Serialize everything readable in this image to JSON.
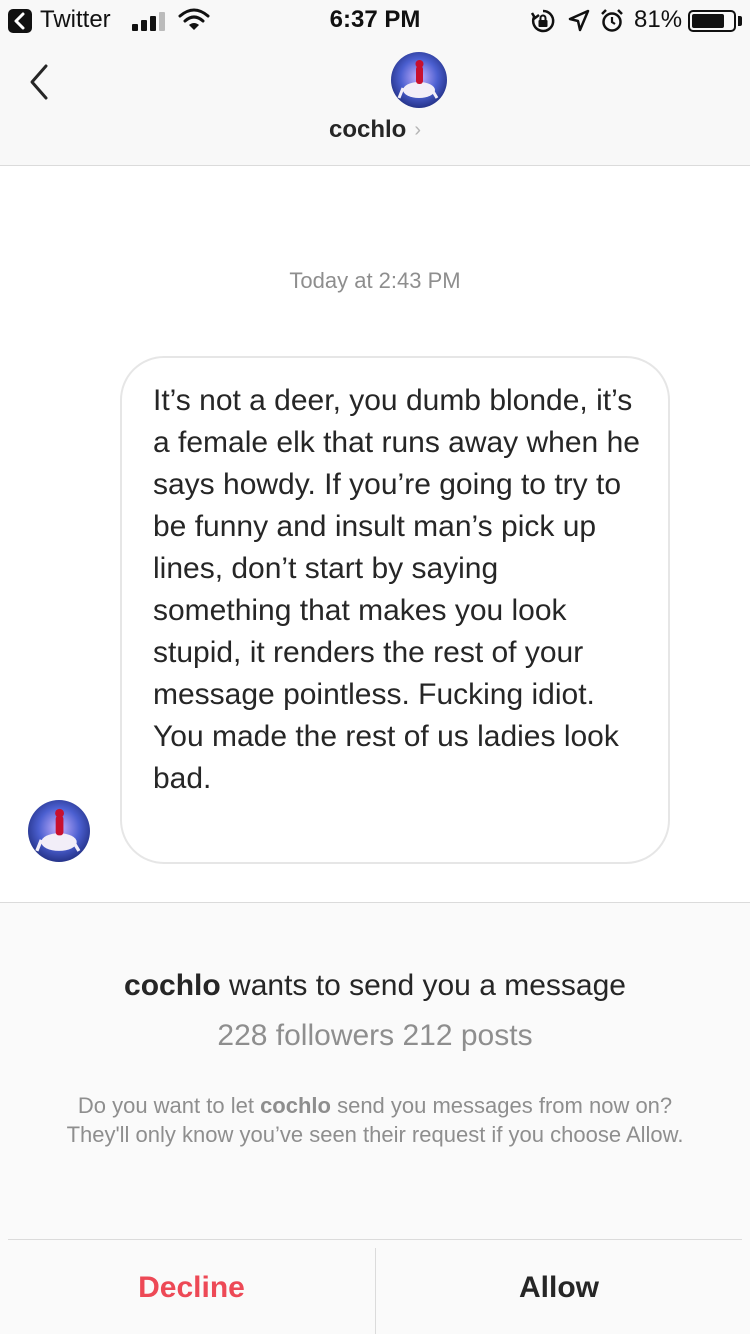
{
  "status_bar": {
    "app_name": "Twitter",
    "time": "6:37 PM",
    "battery_percent": "81%",
    "battery_level": 0.81,
    "icons": [
      "back-to-app-icon",
      "signal-icon",
      "wifi-icon",
      "rotation-lock-icon",
      "location-icon",
      "alarm-icon",
      "battery-icon"
    ]
  },
  "header": {
    "username": "cochlo",
    "chevron": "›"
  },
  "chat": {
    "timestamp": "Today at 2:43 PM",
    "message": "It’s not a deer, you dumb blonde, it’s a female elk that runs away when he says howdy. If you’re going to try to be funny and insult man’s pick up lines, don’t start by saying something that makes you look stupid, it renders the rest of your message pointless. Fucking idiot. You made the rest of us ladies look bad."
  },
  "request": {
    "username": "cochlo",
    "title_suffix": " wants to send you a message",
    "stats": "228 followers 212 posts",
    "desc_prefix": "Do you want to let ",
    "desc_username": "cochlo",
    "desc_suffix": " send you messages from now on? They'll only know you’ve seen their request if you choose Allow.",
    "decline_label": "Decline",
    "allow_label": "Allow"
  },
  "colors": {
    "decline": "#ed4956",
    "secondary_text": "#8e8e8e",
    "primary_text": "#262626"
  }
}
